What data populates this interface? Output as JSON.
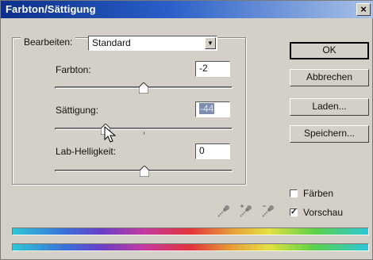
{
  "window": {
    "title": "Farbton/Sättigung",
    "close_symbol": "×"
  },
  "edit": {
    "label": "Bearbeiten:",
    "value": "Standard"
  },
  "controls": [
    {
      "label": "Farbton:",
      "value": "-2",
      "selected": false,
      "slider_fraction": 0.49
    },
    {
      "label": "Sättigung:",
      "value": "-44",
      "selected": true,
      "slider_fraction": 0.28
    },
    {
      "label": "Lab-Helligkeit:",
      "value": "0",
      "selected": false,
      "slider_fraction": 0.5
    }
  ],
  "buttons": {
    "ok": "OK",
    "cancel": "Abbrechen",
    "load": "Laden...",
    "save": "Speichern..."
  },
  "eyedroppers": [
    "eyedropper-icon",
    "eyedropper-plus-icon",
    "eyedropper-minus-icon"
  ],
  "options": {
    "colorize": {
      "label": "Färben",
      "checked": false
    },
    "preview": {
      "label": "Vorschau",
      "checked": true,
      "check_symbol": "✓"
    }
  },
  "colors": {
    "titlebar_start": "#0b2f8a",
    "titlebar_end": "#a9c2e8",
    "dialog_bg": "#d4d0c8"
  }
}
